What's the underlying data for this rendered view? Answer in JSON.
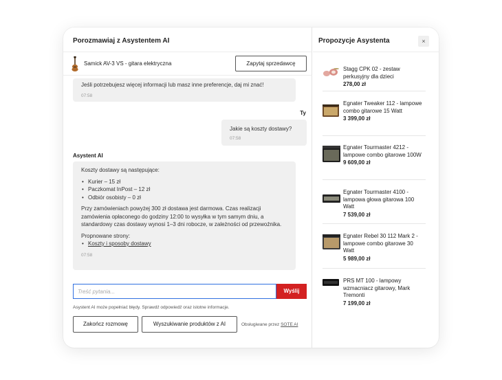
{
  "chat": {
    "title": "Porozmawiaj z Asystentem AI",
    "product_name": "Samick AV-3 VS - gitara elektryczna",
    "ask_seller_label": "Zapytaj sprzedawcę",
    "messages": [
      {
        "text": "Jeśli potrzebujesz więcej informacji lub masz inne preferencje, daj mi znać!",
        "time": "07:58"
      },
      {
        "sender": "Ty",
        "text": "Jakie są koszty dostawy?",
        "time": "07:58"
      },
      {
        "sender": "Asystent AI",
        "intro": "Koszty dostawy są następujące:",
        "list": [
          "Kurier – 15 zł",
          "Paczkomat InPost – 12 zł",
          "Odbiór osobisty – 0 zł"
        ],
        "body": "Przy zamówieniach powyżej 300 zł dostawa jest darmowa. Czas realizacji zamówienia opłaconego do godziny 12:00 to wysyłka w tym samym dniu, a standardowy czas dostawy wynosi 1–3 dni robocze, w zależności od przewoźnika.",
        "pages_label": "Propnowane strony:",
        "link": "Koszty i sposoby dostawy",
        "time": "07:58"
      }
    ],
    "input_placeholder": "Treść pytania...",
    "send_label": "Wyślij",
    "disclaimer": "Asystent AI może popełniać błędy. Sprawdź odpowiedź oraz istotne informacje.",
    "end_label": "Zakończ rozmowę",
    "search_label": "Wyszukiwanie produktów z AI",
    "powered_prefix": "Obsługiwane przez",
    "powered_brand": "SOTE AI"
  },
  "suggestions": {
    "title": "Propozycje Asystenta",
    "close_icon": "×",
    "items": [
      {
        "name": "Stagg CPK 02 - zestaw perkusyjny dla dzieci",
        "price": "278,00 zł",
        "icon": "drum-kit-icon"
      },
      {
        "name": "Egnater Tweaker 112 - lampowe combo gitarowe 15 Watt",
        "price": "3 399,00 zł",
        "icon": "combo-amp-icon"
      },
      {
        "name": "Egnater Tourmaster 4212 - lampowe combo gitarowe 100W",
        "price": "9 609,00 zł",
        "icon": "combo-amp-icon"
      },
      {
        "name": "Egnater Tourmaster 4100 - lampowa głowa gitarowa 100 Watt",
        "price": "7 539,00 zł",
        "icon": "amp-head-icon"
      },
      {
        "name": "Egnater Rebel 30 112 Mark 2 - lampowe combo gitarowe 30 Watt",
        "price": "5 989,00 zł",
        "icon": "combo-amp-icon"
      },
      {
        "name": "PRS MT 100 - lampowy wzmacniacz gitarowy, Mark Tremonti",
        "price": "7 199,00 zł",
        "icon": "amp-head-icon"
      }
    ]
  },
  "colors": {
    "accent": "#d32121",
    "input_focus": "#2f6fe0",
    "bubble": "#f0f0f0"
  }
}
